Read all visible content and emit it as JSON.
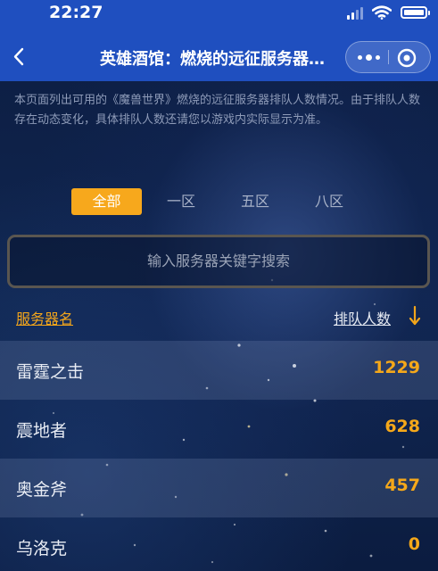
{
  "status_bar": {
    "time": "22:27"
  },
  "nav": {
    "title": "英雄酒馆：燃烧的远征服务器排队人数"
  },
  "intro": {
    "text": "本页面列出可用的《魔兽世界》燃烧的远征服务器排队人数情况。由于排队人数存在动态变化，具体排队人数还请您以游戏内实际显示为准。"
  },
  "region_tabs": [
    {
      "label": "全部",
      "active": true
    },
    {
      "label": "一区",
      "active": false
    },
    {
      "label": "五区",
      "active": false
    },
    {
      "label": "八区",
      "active": false
    }
  ],
  "search": {
    "placeholder": "输入服务器关键字搜索"
  },
  "list_header": {
    "name_label": "服务器名",
    "count_label": "排队人数"
  },
  "servers": [
    {
      "name": "雷霆之击",
      "count": "1229"
    },
    {
      "name": "震地者",
      "count": "628"
    },
    {
      "name": "奥金斧",
      "count": "457"
    },
    {
      "name": "乌洛克",
      "count": "0"
    }
  ],
  "colors": {
    "nav_blue": "#1f4fbf",
    "accent_orange": "#f7a81c",
    "count_orange": "#f5a81a"
  }
}
